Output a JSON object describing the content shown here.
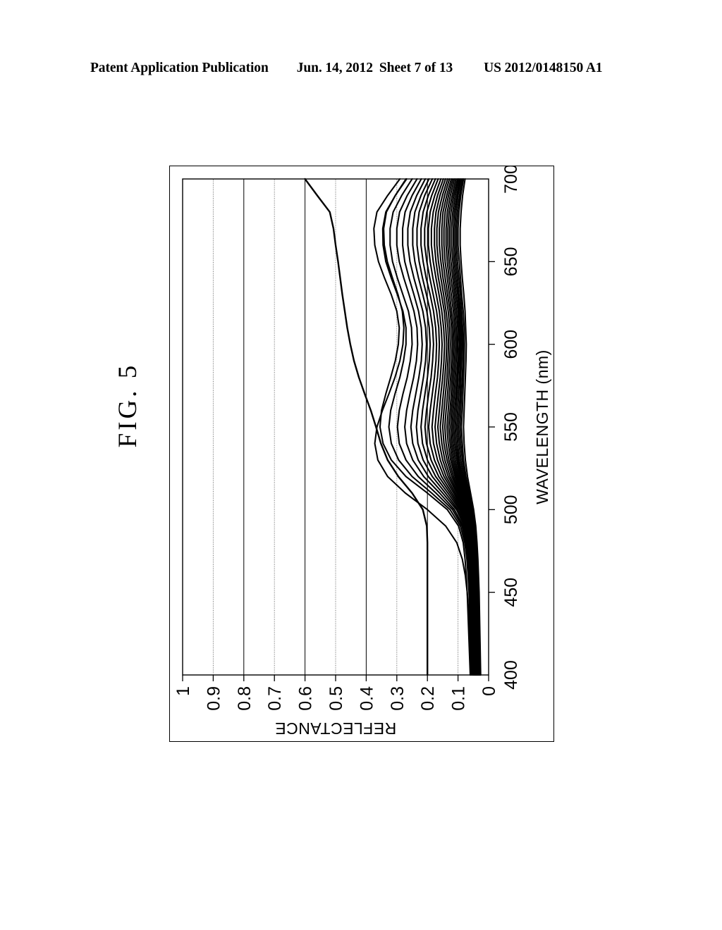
{
  "header": {
    "publication": "Patent Application Publication",
    "date": "Jun. 14, 2012",
    "sheet": "Sheet 7 of 13",
    "patent_number": "US 2012/0148150 A1"
  },
  "figure": {
    "caption": "FIG. 5"
  },
  "chart_data": {
    "type": "line",
    "title": "",
    "xlabel": "WAVELENGTH (nm)",
    "ylabel": "REFLECTANCE",
    "xlim": [
      400,
      700
    ],
    "ylim": [
      0,
      1
    ],
    "xticks": [
      400,
      450,
      500,
      550,
      600,
      650,
      700
    ],
    "xticklabels": [
      "400",
      "450",
      "500",
      "550",
      "600",
      "650",
      "700"
    ],
    "yticks": [
      0,
      0.1,
      0.2,
      0.3,
      0.4,
      0.5,
      0.6,
      0.7,
      0.8,
      0.9,
      1
    ],
    "yticklabels": [
      "0",
      "0.1",
      "0.2",
      "0.3",
      "0.4",
      "0.5",
      "0.6",
      "0.7",
      "0.8",
      "0.9",
      "1"
    ],
    "grid": true,
    "grid_axis": "y",
    "legend": false,
    "rotation_deg": -90,
    "line_color": "#000000",
    "x": [
      400,
      410,
      420,
      430,
      440,
      450,
      460,
      470,
      480,
      490,
      500,
      510,
      520,
      530,
      540,
      550,
      560,
      570,
      580,
      590,
      600,
      610,
      620,
      630,
      640,
      650,
      660,
      670,
      680,
      690,
      700
    ],
    "series": [
      {
        "name": "outlier-high",
        "values": [
          0.2,
          0.2,
          0.2,
          0.2,
          0.2,
          0.2,
          0.2,
          0.2,
          0.2,
          0.202,
          0.215,
          0.25,
          0.295,
          0.33,
          0.352,
          0.368,
          0.385,
          0.405,
          0.424,
          0.44,
          0.452,
          0.462,
          0.47,
          0.478,
          0.485,
          0.492,
          0.5,
          0.507,
          0.519,
          0.56,
          0.6
        ]
      },
      {
        "name": "curve-02",
        "values": [
          0.06,
          0.062,
          0.064,
          0.066,
          0.068,
          0.07,
          0.073,
          0.077,
          0.083,
          0.098,
          0.135,
          0.2,
          0.27,
          0.318,
          0.345,
          0.355,
          0.35,
          0.336,
          0.32,
          0.305,
          0.295,
          0.292,
          0.3,
          0.318,
          0.34,
          0.36,
          0.372,
          0.375,
          0.365,
          0.33,
          0.29
        ]
      },
      {
        "name": "curve-03",
        "values": [
          0.055,
          0.056,
          0.058,
          0.06,
          0.062,
          0.064,
          0.067,
          0.071,
          0.078,
          0.092,
          0.126,
          0.186,
          0.25,
          0.294,
          0.318,
          0.326,
          0.32,
          0.306,
          0.29,
          0.278,
          0.27,
          0.27,
          0.28,
          0.298,
          0.318,
          0.336,
          0.345,
          0.346,
          0.336,
          0.305,
          0.268
        ]
      },
      {
        "name": "curve-04",
        "values": [
          0.052,
          0.053,
          0.055,
          0.057,
          0.059,
          0.061,
          0.064,
          0.068,
          0.074,
          0.087,
          0.118,
          0.172,
          0.23,
          0.27,
          0.292,
          0.298,
          0.292,
          0.28,
          0.266,
          0.256,
          0.25,
          0.252,
          0.262,
          0.28,
          0.298,
          0.314,
          0.322,
          0.322,
          0.312,
          0.284,
          0.25
        ]
      },
      {
        "name": "curve-05",
        "values": [
          0.05,
          0.051,
          0.052,
          0.054,
          0.056,
          0.058,
          0.061,
          0.065,
          0.071,
          0.083,
          0.112,
          0.16,
          0.212,
          0.248,
          0.268,
          0.274,
          0.268,
          0.257,
          0.245,
          0.236,
          0.232,
          0.234,
          0.244,
          0.26,
          0.277,
          0.292,
          0.3,
          0.3,
          0.291,
          0.266,
          0.234
        ]
      },
      {
        "name": "curve-06",
        "values": [
          0.048,
          0.049,
          0.05,
          0.052,
          0.054,
          0.056,
          0.059,
          0.062,
          0.068,
          0.079,
          0.105,
          0.15,
          0.197,
          0.23,
          0.248,
          0.254,
          0.248,
          0.238,
          0.228,
          0.22,
          0.217,
          0.22,
          0.229,
          0.244,
          0.26,
          0.274,
          0.281,
          0.281,
          0.273,
          0.25,
          0.22
        ]
      },
      {
        "name": "curve-07",
        "values": [
          0.046,
          0.047,
          0.048,
          0.05,
          0.052,
          0.054,
          0.056,
          0.06,
          0.065,
          0.075,
          0.1,
          0.141,
          0.184,
          0.214,
          0.231,
          0.236,
          0.231,
          0.222,
          0.213,
          0.206,
          0.203,
          0.206,
          0.215,
          0.229,
          0.244,
          0.257,
          0.264,
          0.264,
          0.256,
          0.235,
          0.207
        ]
      },
      {
        "name": "curve-08",
        "values": [
          0.045,
          0.046,
          0.047,
          0.048,
          0.05,
          0.052,
          0.054,
          0.058,
          0.063,
          0.072,
          0.095,
          0.133,
          0.173,
          0.2,
          0.216,
          0.221,
          0.216,
          0.208,
          0.2,
          0.194,
          0.191,
          0.194,
          0.202,
          0.215,
          0.229,
          0.241,
          0.248,
          0.248,
          0.241,
          0.221,
          0.195
        ]
      },
      {
        "name": "curve-09",
        "values": [
          0.044,
          0.045,
          0.046,
          0.047,
          0.049,
          0.05,
          0.053,
          0.056,
          0.061,
          0.069,
          0.091,
          0.126,
          0.163,
          0.188,
          0.203,
          0.208,
          0.203,
          0.196,
          0.188,
          0.183,
          0.18,
          0.183,
          0.191,
          0.203,
          0.216,
          0.227,
          0.234,
          0.234,
          0.227,
          0.209,
          0.184
        ]
      },
      {
        "name": "curve-10",
        "values": [
          0.043,
          0.044,
          0.045,
          0.046,
          0.047,
          0.049,
          0.051,
          0.054,
          0.059,
          0.067,
          0.087,
          0.12,
          0.154,
          0.177,
          0.191,
          0.196,
          0.191,
          0.184,
          0.177,
          0.172,
          0.17,
          0.173,
          0.18,
          0.191,
          0.204,
          0.214,
          0.221,
          0.221,
          0.214,
          0.197,
          0.174
        ]
      },
      {
        "name": "curve-11",
        "values": [
          0.042,
          0.043,
          0.044,
          0.045,
          0.046,
          0.048,
          0.05,
          0.053,
          0.057,
          0.065,
          0.084,
          0.114,
          0.146,
          0.167,
          0.18,
          0.185,
          0.18,
          0.174,
          0.167,
          0.163,
          0.161,
          0.163,
          0.17,
          0.181,
          0.192,
          0.202,
          0.209,
          0.209,
          0.202,
          0.186,
          0.165
        ]
      },
      {
        "name": "curve-12",
        "values": [
          0.041,
          0.042,
          0.043,
          0.044,
          0.045,
          0.047,
          0.049,
          0.051,
          0.056,
          0.063,
          0.081,
          0.109,
          0.139,
          0.158,
          0.17,
          0.175,
          0.17,
          0.164,
          0.158,
          0.154,
          0.152,
          0.155,
          0.161,
          0.171,
          0.182,
          0.191,
          0.197,
          0.197,
          0.191,
          0.176,
          0.156
        ]
      },
      {
        "name": "curve-13",
        "values": [
          0.04,
          0.041,
          0.042,
          0.043,
          0.044,
          0.046,
          0.048,
          0.05,
          0.054,
          0.061,
          0.078,
          0.104,
          0.132,
          0.15,
          0.161,
          0.166,
          0.161,
          0.156,
          0.15,
          0.146,
          0.144,
          0.147,
          0.153,
          0.162,
          0.172,
          0.181,
          0.187,
          0.187,
          0.181,
          0.167,
          0.148
        ]
      },
      {
        "name": "curve-14",
        "values": [
          0.039,
          0.04,
          0.041,
          0.042,
          0.043,
          0.045,
          0.047,
          0.049,
          0.053,
          0.06,
          0.076,
          0.1,
          0.126,
          0.143,
          0.153,
          0.158,
          0.153,
          0.148,
          0.143,
          0.139,
          0.137,
          0.14,
          0.145,
          0.154,
          0.164,
          0.172,
          0.177,
          0.177,
          0.172,
          0.159,
          0.141
        ]
      },
      {
        "name": "curve-15",
        "values": [
          0.038,
          0.039,
          0.04,
          0.041,
          0.042,
          0.044,
          0.046,
          0.048,
          0.052,
          0.058,
          0.074,
          0.096,
          0.12,
          0.136,
          0.146,
          0.15,
          0.146,
          0.141,
          0.136,
          0.133,
          0.131,
          0.133,
          0.139,
          0.147,
          0.156,
          0.164,
          0.169,
          0.169,
          0.164,
          0.151,
          0.134
        ]
      },
      {
        "name": "curve-16",
        "values": [
          0.037,
          0.038,
          0.039,
          0.04,
          0.041,
          0.043,
          0.045,
          0.047,
          0.051,
          0.057,
          0.072,
          0.093,
          0.115,
          0.13,
          0.139,
          0.143,
          0.139,
          0.134,
          0.13,
          0.127,
          0.125,
          0.127,
          0.132,
          0.14,
          0.149,
          0.156,
          0.161,
          0.161,
          0.156,
          0.144,
          0.128
        ]
      },
      {
        "name": "curve-17",
        "values": [
          0.036,
          0.037,
          0.038,
          0.039,
          0.04,
          0.042,
          0.044,
          0.046,
          0.05,
          0.056,
          0.07,
          0.09,
          0.11,
          0.124,
          0.132,
          0.136,
          0.132,
          0.128,
          0.124,
          0.121,
          0.119,
          0.121,
          0.126,
          0.134,
          0.142,
          0.149,
          0.153,
          0.153,
          0.149,
          0.137,
          0.122
        ]
      },
      {
        "name": "curve-18",
        "values": [
          0.035,
          0.036,
          0.037,
          0.038,
          0.039,
          0.041,
          0.043,
          0.045,
          0.049,
          0.055,
          0.068,
          0.087,
          0.106,
          0.119,
          0.126,
          0.13,
          0.126,
          0.122,
          0.119,
          0.116,
          0.114,
          0.116,
          0.121,
          0.128,
          0.135,
          0.142,
          0.146,
          0.146,
          0.142,
          0.131,
          0.117
        ]
      },
      {
        "name": "curve-19",
        "values": [
          0.034,
          0.035,
          0.036,
          0.037,
          0.038,
          0.04,
          0.042,
          0.044,
          0.048,
          0.054,
          0.066,
          0.084,
          0.102,
          0.114,
          0.121,
          0.124,
          0.121,
          0.117,
          0.114,
          0.111,
          0.109,
          0.111,
          0.115,
          0.122,
          0.129,
          0.135,
          0.139,
          0.139,
          0.135,
          0.125,
          0.112
        ]
      },
      {
        "name": "curve-20",
        "values": [
          0.033,
          0.034,
          0.035,
          0.036,
          0.037,
          0.039,
          0.041,
          0.043,
          0.047,
          0.052,
          0.064,
          0.081,
          0.098,
          0.109,
          0.116,
          0.119,
          0.116,
          0.112,
          0.109,
          0.106,
          0.104,
          0.106,
          0.11,
          0.116,
          0.123,
          0.129,
          0.133,
          0.133,
          0.129,
          0.119,
          0.107
        ]
      },
      {
        "name": "curve-21",
        "values": [
          0.032,
          0.033,
          0.034,
          0.035,
          0.036,
          0.038,
          0.04,
          0.042,
          0.046,
          0.051,
          0.062,
          0.078,
          0.094,
          0.104,
          0.111,
          0.114,
          0.111,
          0.107,
          0.104,
          0.101,
          0.1,
          0.101,
          0.105,
          0.111,
          0.117,
          0.123,
          0.127,
          0.127,
          0.123,
          0.114,
          0.102
        ]
      },
      {
        "name": "curve-22",
        "values": [
          0.031,
          0.032,
          0.033,
          0.034,
          0.035,
          0.037,
          0.039,
          0.041,
          0.044,
          0.05,
          0.06,
          0.075,
          0.09,
          0.1,
          0.106,
          0.109,
          0.106,
          0.103,
          0.1,
          0.097,
          0.095,
          0.097,
          0.1,
          0.106,
          0.112,
          0.117,
          0.121,
          0.121,
          0.117,
          0.109,
          0.098
        ]
      },
      {
        "name": "curve-23",
        "values": [
          0.03,
          0.031,
          0.032,
          0.033,
          0.034,
          0.036,
          0.038,
          0.04,
          0.043,
          0.048,
          0.058,
          0.072,
          0.086,
          0.096,
          0.101,
          0.104,
          0.101,
          0.098,
          0.095,
          0.093,
          0.091,
          0.093,
          0.096,
          0.101,
          0.107,
          0.112,
          0.115,
          0.115,
          0.112,
          0.104,
          0.094
        ]
      },
      {
        "name": "curve-24",
        "values": [
          0.029,
          0.03,
          0.031,
          0.032,
          0.033,
          0.035,
          0.037,
          0.039,
          0.042,
          0.047,
          0.056,
          0.069,
          0.082,
          0.091,
          0.096,
          0.099,
          0.096,
          0.093,
          0.091,
          0.089,
          0.087,
          0.089,
          0.092,
          0.097,
          0.102,
          0.107,
          0.11,
          0.11,
          0.107,
          0.1,
          0.09
        ]
      },
      {
        "name": "curve-25",
        "values": [
          0.028,
          0.029,
          0.03,
          0.031,
          0.032,
          0.034,
          0.036,
          0.038,
          0.041,
          0.045,
          0.054,
          0.066,
          0.078,
          0.086,
          0.091,
          0.094,
          0.091,
          0.089,
          0.086,
          0.084,
          0.083,
          0.085,
          0.088,
          0.092,
          0.097,
          0.102,
          0.105,
          0.105,
          0.102,
          0.095,
          0.086
        ]
      },
      {
        "name": "curve-26",
        "values": [
          0.027,
          0.028,
          0.029,
          0.03,
          0.031,
          0.033,
          0.035,
          0.037,
          0.04,
          0.044,
          0.052,
          0.063,
          0.074,
          0.082,
          0.086,
          0.089,
          0.086,
          0.084,
          0.082,
          0.08,
          0.079,
          0.08,
          0.083,
          0.088,
          0.092,
          0.096,
          0.1,
          0.1,
          0.097,
          0.091,
          0.082
        ]
      },
      {
        "name": "curve-27-low",
        "values": [
          0.026,
          0.027,
          0.028,
          0.029,
          0.03,
          0.031,
          0.033,
          0.035,
          0.038,
          0.042,
          0.049,
          0.059,
          0.069,
          0.076,
          0.08,
          0.082,
          0.08,
          0.078,
          0.076,
          0.074,
          0.073,
          0.075,
          0.077,
          0.081,
          0.086,
          0.09,
          0.093,
          0.093,
          0.09,
          0.085,
          0.077
        ]
      },
      {
        "name": "curve-28-mid",
        "values": [
          0.058,
          0.059,
          0.061,
          0.063,
          0.066,
          0.07,
          0.076,
          0.086,
          0.104,
          0.14,
          0.2,
          0.272,
          0.33,
          0.362,
          0.372,
          0.365,
          0.347,
          0.326,
          0.306,
          0.29,
          0.28,
          0.277,
          0.282,
          0.296,
          0.314,
          0.331,
          0.341,
          0.343,
          0.334,
          0.305,
          0.27
        ]
      }
    ]
  }
}
